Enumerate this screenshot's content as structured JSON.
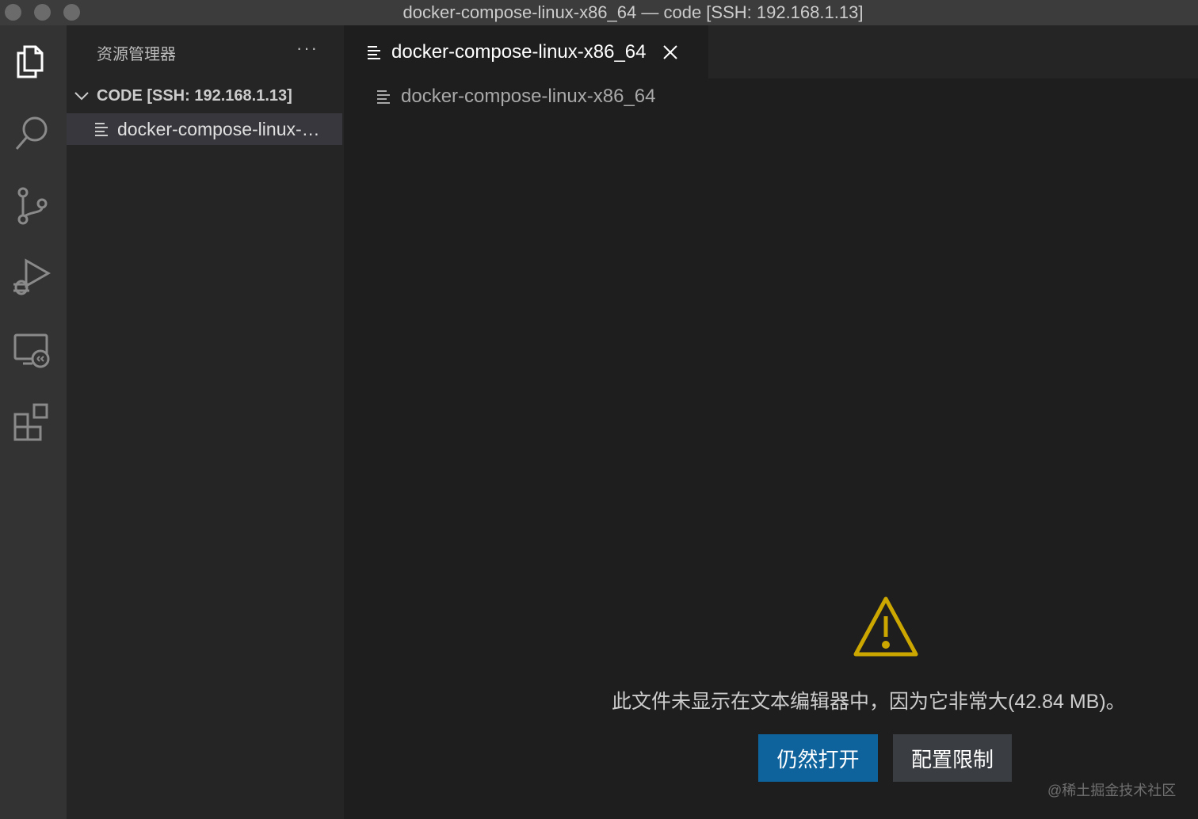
{
  "window": {
    "title": "docker-compose-linux-x86_64 — code [SSH: 192.168.1.13]"
  },
  "activity_bar": {
    "items": [
      {
        "icon": "files-icon"
      },
      {
        "icon": "search-icon"
      },
      {
        "icon": "source-control-icon"
      },
      {
        "icon": "run-debug-icon"
      },
      {
        "icon": "remote-explorer-icon"
      },
      {
        "icon": "extensions-icon"
      }
    ]
  },
  "sidebar": {
    "title": "资源管理器",
    "more_label": "···",
    "folder_label": "CODE [SSH: 192.168.1.13]",
    "file_label": "docker-compose-linux-…"
  },
  "editor": {
    "tab_label": "docker-compose-linux-x86_64",
    "breadcrumb": "docker-compose-linux-x86_64",
    "message": "此文件未显示在文本编辑器中，因为它非常大(42.84 MB)。",
    "open_anyway_label": "仍然打开",
    "configure_limit_label": "配置限制"
  },
  "watermark": "@稀土掘金技术社区",
  "colors": {
    "accent": "#0e639c",
    "warning": "#cca700"
  }
}
